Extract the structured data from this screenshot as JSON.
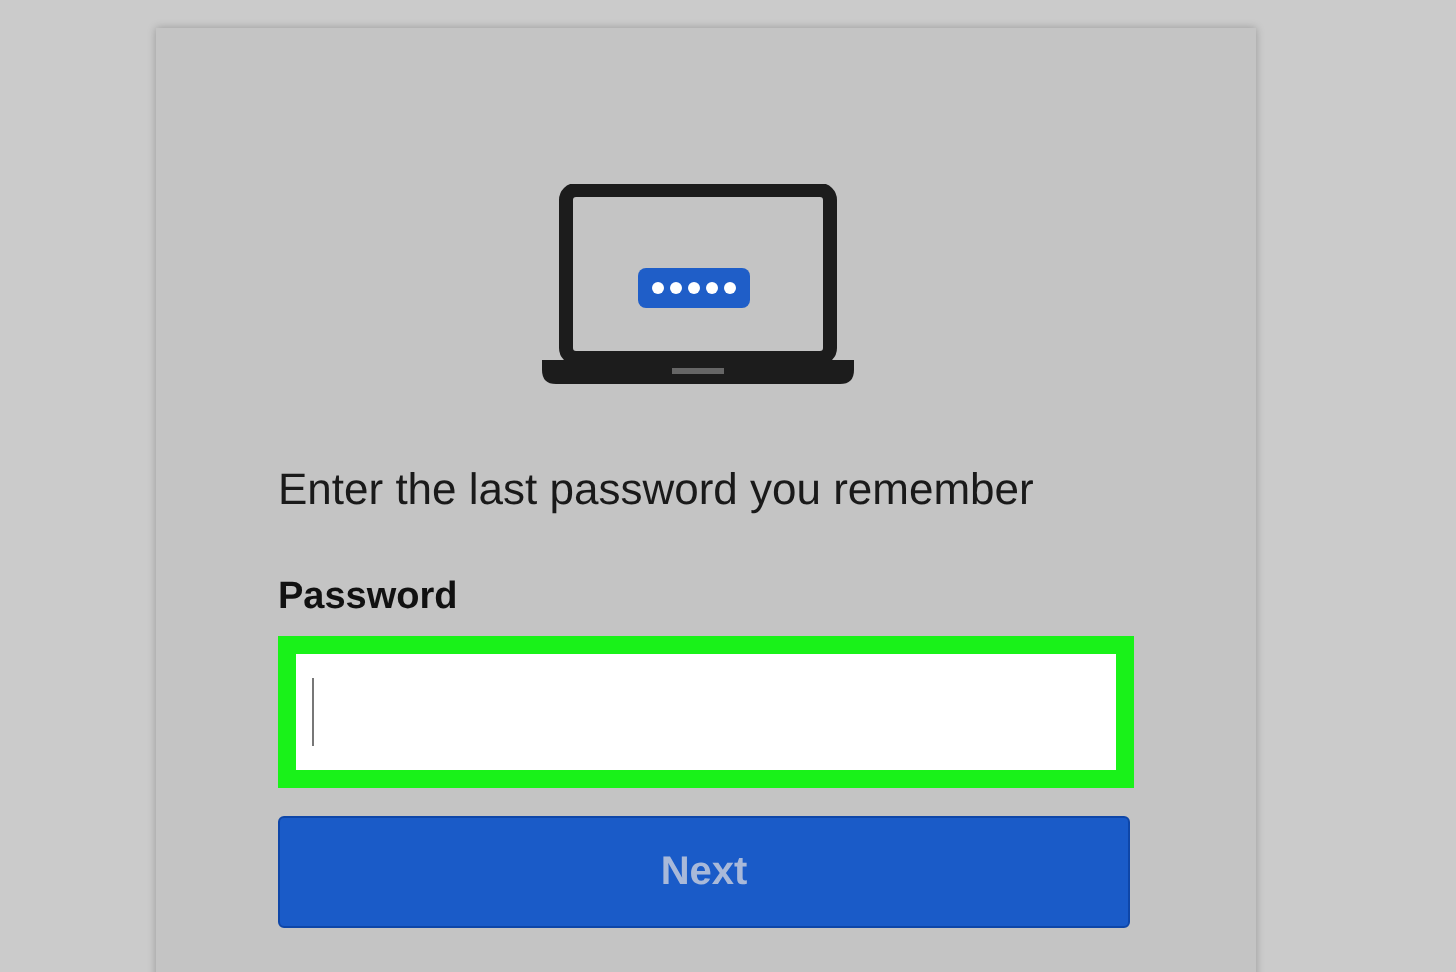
{
  "prompt": "Enter the last password you remember",
  "password_field": {
    "label": "Password",
    "focused": true,
    "highlighted": true
  },
  "next_button": {
    "label": "Next",
    "disabled": true
  }
}
